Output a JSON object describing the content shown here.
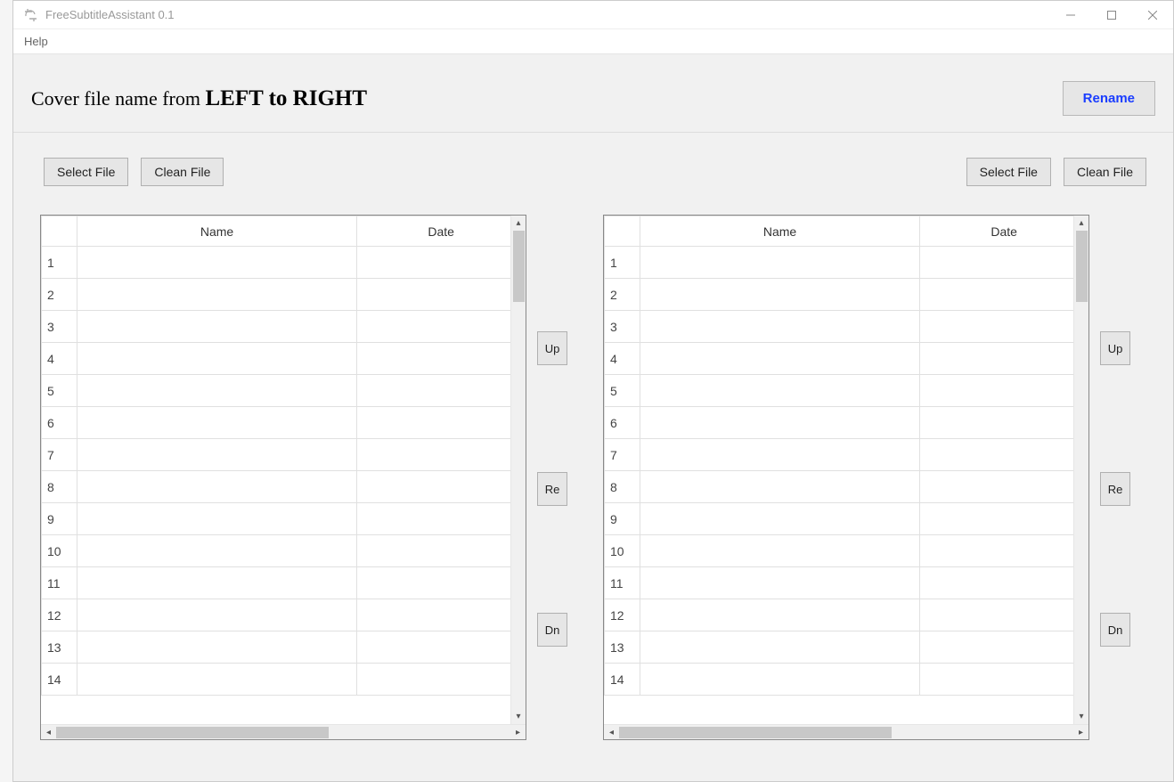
{
  "window": {
    "title": "FreeSubtitleAssistant 0.1"
  },
  "menu": {
    "help": "Help"
  },
  "header": {
    "prefix": "Cover file name from ",
    "emph": "LEFT to RIGHT",
    "rename": "Rename"
  },
  "left_panel": {
    "select_file": "Select File",
    "clean_file": "Clean File",
    "columns": {
      "name": "Name",
      "date": "Date"
    },
    "rows": [
      "1",
      "2",
      "3",
      "4",
      "5",
      "6",
      "7",
      "8",
      "9",
      "10",
      "11",
      "12",
      "13",
      "14"
    ],
    "up": "Up",
    "re": "Re",
    "dn": "Dn"
  },
  "right_panel": {
    "select_file": "Select File",
    "clean_file": "Clean File",
    "columns": {
      "name": "Name",
      "date": "Date"
    },
    "rows": [
      "1",
      "2",
      "3",
      "4",
      "5",
      "6",
      "7",
      "8",
      "9",
      "10",
      "11",
      "12",
      "13",
      "14"
    ],
    "up": "Up",
    "re": "Re",
    "dn": "Dn"
  }
}
